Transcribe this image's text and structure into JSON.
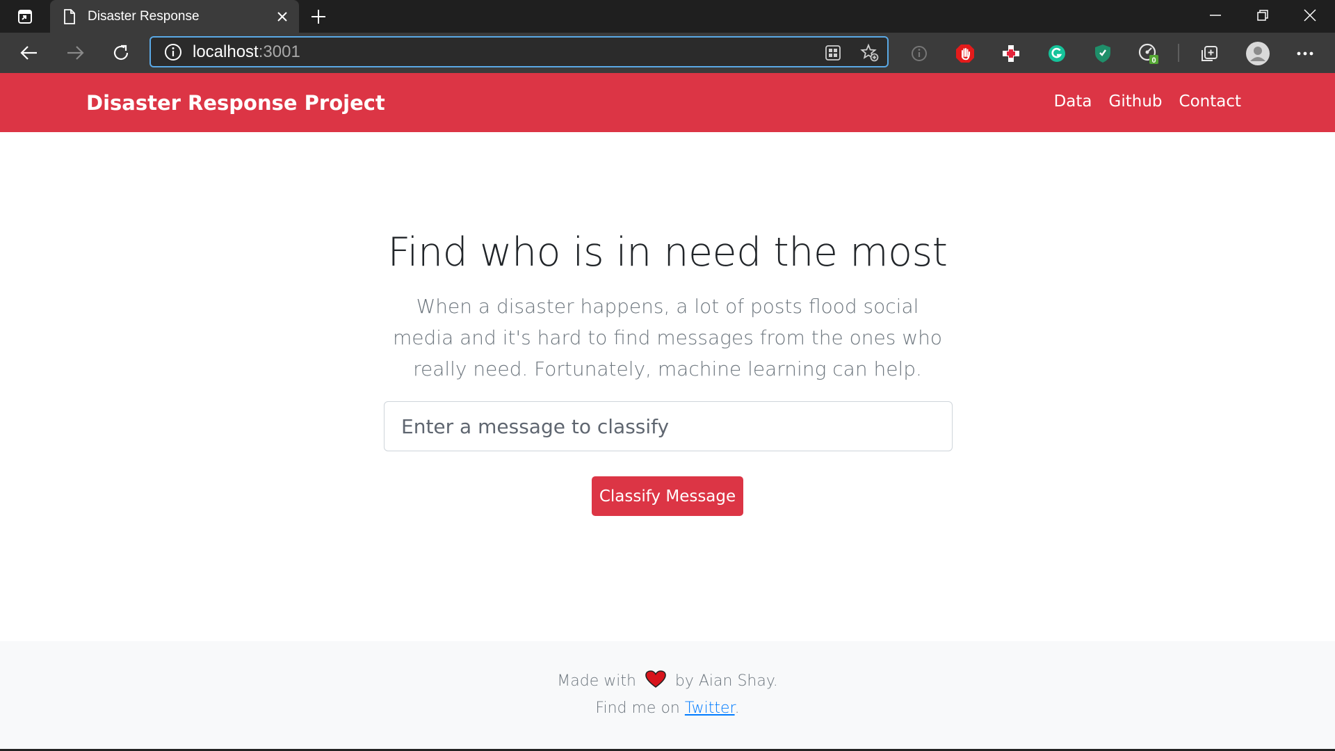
{
  "browser": {
    "tab_title": "Disaster Response",
    "url_host": "localhost",
    "url_port": ":3001",
    "icons": [
      "tab-actions-icon",
      "page-icon",
      "close-icon",
      "plus-icon",
      "minimize-icon",
      "restore-icon",
      "close-window-icon",
      "back-icon",
      "forward-icon",
      "refresh-icon",
      "info-icon",
      "apps-icon",
      "favorite-add-icon"
    ],
    "extensions": [
      "tracker-info-icon",
      "stop-hand-icon",
      "medic-cross-icon",
      "grammarly-icon",
      "shield-icon",
      "performance-icon",
      "collections-icon",
      "profile-icon",
      "more-icon"
    ],
    "extension_badge": "0"
  },
  "navbar": {
    "brand": "Disaster Response Project",
    "links": [
      "Data",
      "Github",
      "Contact"
    ],
    "color": "#dc3545"
  },
  "hero": {
    "title": "Find who is in need the most",
    "lead": "When a disaster happens, a lot of posts flood social media and it's hard to find messages from the ones who really need. Fortunately, machine learning can help.",
    "input_placeholder": "Enter a message to classify",
    "button_label": "Classify Message"
  },
  "footer": {
    "made_with": "Made with",
    "by": "by Aian Shay.",
    "find_me": "Find me on",
    "twitter": "Twitter",
    "period": "."
  }
}
